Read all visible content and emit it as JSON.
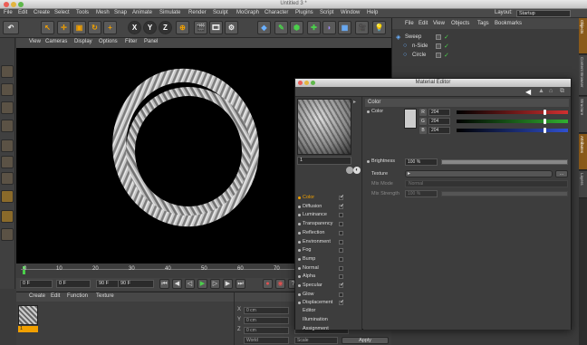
{
  "window": {
    "title": "Untitled 3 *"
  },
  "menubar": {
    "items": [
      "File",
      "Edit",
      "Create",
      "Select",
      "Tools",
      "Mesh",
      "Snap",
      "Animate",
      "Simulate",
      "Render",
      "Sculpt",
      "MoGraph",
      "Character",
      "Plugins",
      "Script",
      "Window",
      "Help"
    ],
    "layout_label": "Layout:",
    "layout_value": "Startup"
  },
  "toolbar": {
    "axis": [
      "X",
      "Y",
      "Z"
    ]
  },
  "viewport": {
    "menu": [
      "View",
      "Cameras",
      "Display",
      "Options",
      "Filter",
      "Panel"
    ]
  },
  "timeline": {
    "ticks": [
      "0",
      "10",
      "20",
      "30",
      "40",
      "50",
      "60",
      "70",
      "80",
      "90"
    ],
    "end_label": "0 F"
  },
  "playback": {
    "current_frame": "0 F",
    "start_frame": "0 F",
    "end_frame": "90 F",
    "end_frame2": "90 F"
  },
  "material_manager": {
    "menu": [
      "Create",
      "Edit",
      "Function",
      "Texture"
    ],
    "material_name": "1"
  },
  "coordinates": {
    "rows": [
      {
        "axis": "X",
        "value": "0 cm"
      },
      {
        "axis": "Y",
        "value": "0 cm"
      },
      {
        "axis": "Z",
        "value": "0 cm"
      }
    ],
    "mode": "World",
    "scale": "Scale",
    "apply": "Apply"
  },
  "object_manager": {
    "menu": [
      "File",
      "Edit",
      "View",
      "Objects",
      "Tags",
      "Bookmarks"
    ],
    "objects": [
      {
        "name": "Sweep",
        "indent": 0
      },
      {
        "name": "n-Side",
        "indent": 1
      },
      {
        "name": "Circle",
        "indent": 1
      }
    ]
  },
  "side_tabs": [
    "Objects",
    "Content Browser",
    "Structure",
    "Attributes",
    "Layers"
  ],
  "material_editor": {
    "title": "Material Editor",
    "material_name": "1",
    "channels": [
      {
        "label": "Color",
        "checked": true,
        "active": true
      },
      {
        "label": "Diffusion",
        "checked": true,
        "active": false
      },
      {
        "label": "Luminance",
        "checked": false,
        "active": false
      },
      {
        "label": "Transparency",
        "checked": false,
        "active": false
      },
      {
        "label": "Reflection",
        "checked": false,
        "active": false
      },
      {
        "label": "Environment",
        "checked": false,
        "active": false
      },
      {
        "label": "Fog",
        "checked": false,
        "active": false
      },
      {
        "label": "Bump",
        "checked": false,
        "active": false
      },
      {
        "label": "Normal",
        "checked": false,
        "active": false
      },
      {
        "label": "Alpha",
        "checked": false,
        "active": false
      },
      {
        "label": "Specular",
        "checked": true,
        "active": false
      },
      {
        "label": "Glow",
        "checked": false,
        "active": false
      },
      {
        "label": "Displacement",
        "checked": true,
        "active": false
      }
    ],
    "extra_items": [
      "Editor",
      "Illumination",
      "Assignment"
    ],
    "section": "Color",
    "color_label": "Color",
    "rgb": [
      {
        "ch": "R",
        "value": "204",
        "color": "#d03030"
      },
      {
        "ch": "G",
        "value": "204",
        "color": "#30b030"
      },
      {
        "ch": "B",
        "value": "204",
        "color": "#3050d0"
      }
    ],
    "rgb_fraction": 0.8,
    "brightness_label": "Brightness",
    "brightness": "100 %",
    "brightness_fraction": 1.0,
    "texture_label": "Texture",
    "texture_btn": "...",
    "mix_mode_label": "Mix Mode",
    "mix_mode": "Normal",
    "mix_strength_label": "Mix Strength",
    "mix_strength": "100 %",
    "swatch_color": "#cccccc"
  }
}
